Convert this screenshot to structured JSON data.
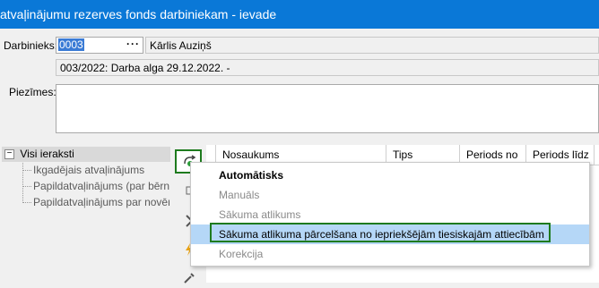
{
  "window": {
    "title": "atvaļinājumu rezerves fonds darbiniekam - ievade"
  },
  "form": {
    "employee_label": "Darbinieks:",
    "employee_code": "0003",
    "employee_name": "Kārlis Auziņš",
    "period_text": "003/2022: Darba alga  29.12.2022. -",
    "notes_label": "Piezīmes:"
  },
  "tree": {
    "root": "Visi ieraksti",
    "items": [
      "Ikgadējais atvaļinājums",
      "Papildatvaļinājums (par bērniem",
      "Papildatvaļinājums par novērtē"
    ]
  },
  "grid": {
    "columns": [
      "Nosaukums",
      "Tips",
      "Periods no",
      "Periods līdz"
    ]
  },
  "menu": {
    "items": [
      {
        "label": "Automātisks",
        "state": "bold"
      },
      {
        "label": "Manuāls",
        "state": "disabled"
      },
      {
        "label": "Sākuma atlikums",
        "state": "disabled"
      },
      {
        "label": "Sākuma atlikuma pārcelšana no iepriekšējām tiesiskajām attiecībām",
        "state": "highlighted"
      },
      {
        "label": "Korekcija",
        "state": "disabled"
      }
    ]
  },
  "colors": {
    "titlebar": "#0a78d7",
    "highlight": "#b5d7f7",
    "outline_green": "#1e7b1e"
  },
  "icons": [
    "ellipsis-icon",
    "add-entry-icon",
    "edit-icon",
    "calculate-icon",
    "lightning-icon",
    "tools-icon"
  ]
}
